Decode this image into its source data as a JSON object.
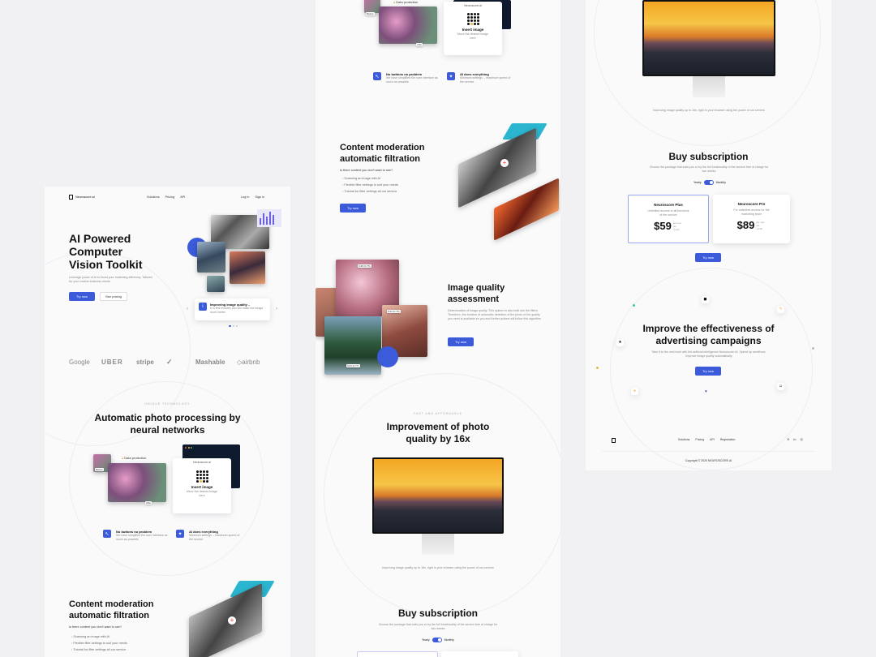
{
  "brand": {
    "name": "Neuroscore.ai",
    "accent": "#3b5bdb"
  },
  "nav": {
    "solutions": "Solutions",
    "pricing": "Pricing",
    "api": "API",
    "login": "Log in",
    "signup": "Sign in"
  },
  "hero": {
    "title": "AI Powered Computer Vision Toolkit",
    "subtitle": "Leverage power of AI to boost your marketing efficiency. Tailored for your custom business needs",
    "try_label": "Try now",
    "pricing_label": "See pricing",
    "notice_title": "Improving image quality –",
    "notice_text": "in a few minutes you will make the image much better"
  },
  "logos": [
    "Google",
    "UBER",
    "stripe",
    "Nike",
    "Mashable",
    "airbnb"
  ],
  "tech": {
    "eyebrow": "UNIQUE TECHNOLOGY",
    "title": "Automatic photo processing by neural networks",
    "data_protection": "Data protection",
    "before": "Before",
    "after": "After",
    "app_name": "Neuroscore.ai",
    "insert_title": "Insert image",
    "insert_text": "Move the desired image here",
    "feature1_title": "No buttons no problem",
    "feature1_text": "We have simplified the user interface as much as possible",
    "feature2_title": "AI does everything",
    "feature2_text": "Minimum settings – maximum speed of the service"
  },
  "moderation": {
    "title": "Content moderation automatic filtration",
    "question": "Is there content you don't want to see?",
    "items": [
      "Scanning an image with AI",
      "Flexible filter settings to suit your needs",
      "Tutorial for filter settings all our service"
    ],
    "try_label": "Try now"
  },
  "quality": {
    "title": "Image quality assessment",
    "text": "Determination of image quality. This system is also built into the filters. Therefore, the function of automatic detection of the photo of the quality you need is available for you and further actions will follow this algorithm",
    "try_label": "Try now",
    "scores": [
      "9.38 (0.76)",
      "8.94 (0.76)",
      "9.04 (0.77)"
    ]
  },
  "improvement": {
    "eyebrow": "FAST AND AFFORDABLE",
    "title": "Improvement of photo quality by 16x",
    "caption": "Improving image quality up to 16x, right in your browser using the power of our servers"
  },
  "subscription": {
    "title": "Buy subscription",
    "text": "Choose the package that suits you or try the full functionality of the service free of charge for two weeks",
    "yearly": "Yearly",
    "monthly": "Monthly",
    "plans": [
      {
        "name": "Neuroscore Plus",
        "desc": "Unlimited access to all functions of the service",
        "price": "$59",
        "period": "per user per month"
      },
      {
        "name": "Neuroscore Pro",
        "desc": "For unlimited access for the marketing team",
        "price": "$89",
        "period": "per user per month"
      }
    ],
    "try_label": "Try now"
  },
  "advertising": {
    "title": "Improve the effectiveness of advertising campaigns",
    "text": "Take it to the next level with the artificial intelligence Neuroscore.AI. Speed up workflows. Improve image quality automatically",
    "try_label": "Try now"
  },
  "footer": {
    "links": [
      "Solutions",
      "Pricing",
      "API",
      "Registration"
    ],
    "copyright": "Copyright © 2020 NEUROSCORE.AI"
  }
}
